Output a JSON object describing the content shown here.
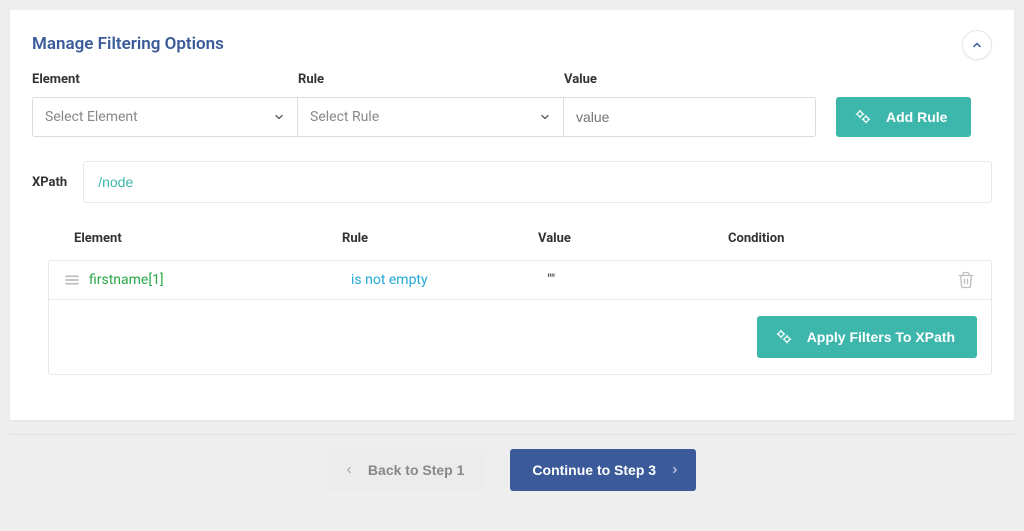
{
  "card": {
    "title": "Manage Filtering Options"
  },
  "fields": {
    "element_label": "Element",
    "rule_label": "Rule",
    "value_label": "Value",
    "element_placeholder": "Select Element",
    "rule_placeholder": "Select Rule",
    "value_placeholder": "value"
  },
  "buttons": {
    "add_rule": "Add Rule",
    "apply_filters": "Apply Filters To XPath",
    "back": "Back to Step 1",
    "continue": "Continue to Step 3"
  },
  "xpath": {
    "label": "XPath",
    "value": "/node"
  },
  "table": {
    "headers": {
      "element": "Element",
      "rule": "Rule",
      "value": "Value",
      "condition": "Condition"
    },
    "rows": [
      {
        "element": "firstname[1]",
        "rule": "is not empty",
        "value": "\"\"",
        "condition": ""
      }
    ]
  }
}
